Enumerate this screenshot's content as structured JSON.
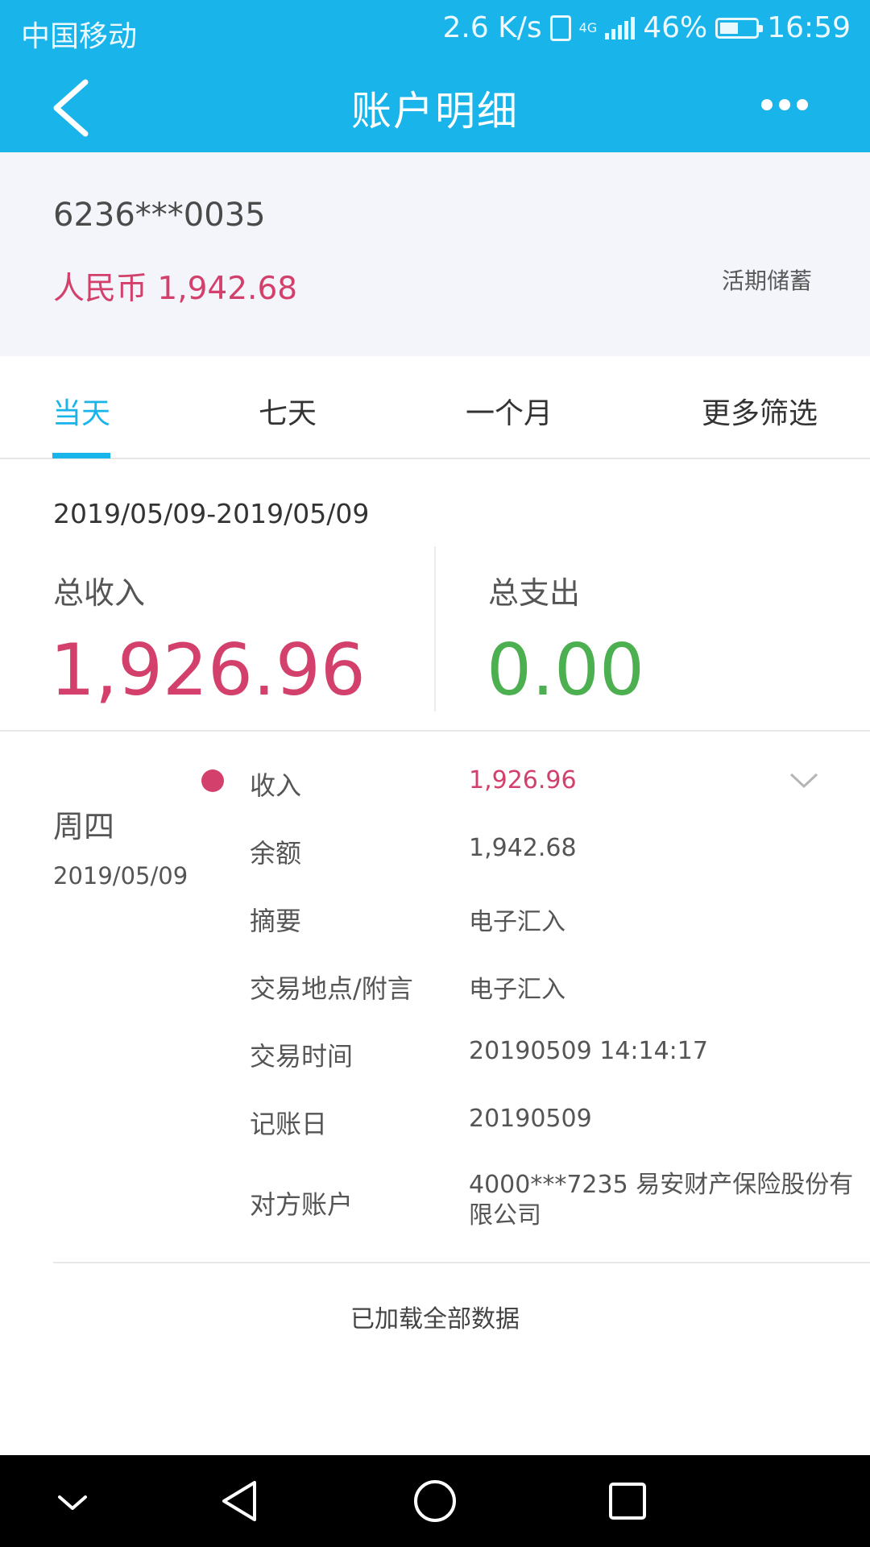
{
  "status_bar": {
    "carrier": "中国移动",
    "speed": "2.6 K/s",
    "network": "4G",
    "battery": "46%",
    "time": "16:59"
  },
  "header": {
    "title": "账户明细",
    "back_icon": "chevron-left-icon",
    "more_icon": "more-horizontal-icon"
  },
  "account": {
    "number": "6236***0035",
    "balance": "人民币 1,942.68",
    "type": "活期储蓄"
  },
  "tabs": [
    {
      "label": "当天",
      "active": true
    },
    {
      "label": "七天",
      "active": false
    },
    {
      "label": "一个月",
      "active": false
    },
    {
      "label": "更多筛选",
      "active": false
    }
  ],
  "summary": {
    "date_range": "2019/05/09-2019/05/09",
    "income_label": "总收入",
    "income_value": "1,926.96",
    "expense_label": "总支出",
    "expense_value": "0.00"
  },
  "transaction": {
    "weekday": "周四",
    "date": "2019/05/09",
    "rows": [
      {
        "label": "收入",
        "value": "1,926.96"
      },
      {
        "label": "余额",
        "value": "1,942.68"
      },
      {
        "label": "摘要",
        "value": "电子汇入"
      },
      {
        "label": "交易地点/附言",
        "value": "电子汇入"
      },
      {
        "label": "交易时间",
        "value": "20190509 14:14:17"
      },
      {
        "label": "记账日",
        "value": "20190509"
      },
      {
        "label": "对方账户",
        "value": "4000***7235 易安财产保险股份有限公司"
      }
    ]
  },
  "footer_text": "已加载全部数据",
  "colors": {
    "brand": "#18b4ea",
    "income": "#d2406b",
    "expense": "#4caf50"
  },
  "nav_bar": {
    "icons": [
      "chevron-down-icon",
      "back-triangle-icon",
      "home-circle-icon",
      "recents-square-icon"
    ]
  }
}
